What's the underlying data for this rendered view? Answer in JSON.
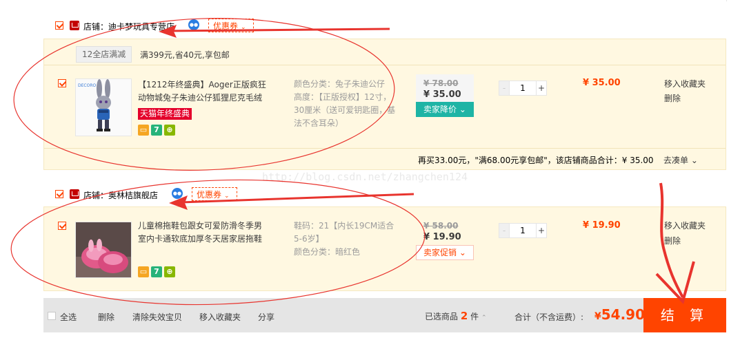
{
  "stores": [
    {
      "store_label": "店铺：",
      "store_name": "迪卡梦玩具专营店",
      "coupon_label": "优惠券",
      "promo_tag": "12全店满减",
      "promo_text": "满399元,省40元,享包邮",
      "item": {
        "title_line1": "【1212年终盛典】Aoger正版疯狂",
        "title_line2": "动物城兔子朱迪公仔狐狸尼克毛绒",
        "tmall_tag": "天猫年终盛典",
        "sku_line1": "颜色分类：兔子朱迪公仔",
        "sku_line2": "高度：【正版授权】12寸，",
        "sku_line3": "30厘米（送可爱钥匙圈，基",
        "sku_line4": "法不含耳朵）",
        "old_price": "¥ 78.00",
        "new_price": "¥ 35.00",
        "discount_label": "卖家降价",
        "quantity": "1",
        "subtotal": "¥ 35.00",
        "op_fav": "移入收藏夹",
        "op_del": "删除"
      },
      "footer_text": "再买33.00元，\"满68.00元享包邮\"，该店铺商品合计：¥ 35.00",
      "footer_link": "去凑单"
    },
    {
      "store_label": "店铺：",
      "store_name": "奥林桔旗舰店",
      "coupon_label": "优惠券",
      "item": {
        "title_line1": "儿童棉拖鞋包跟女可爱防滑冬季男",
        "title_line2": "室内卡通软底加厚冬天居家居拖鞋",
        "sku_line1": "鞋码：21【内长19CM适合",
        "sku_line2": "5-6岁】",
        "sku_line3": "颜色分类：暗红色",
        "old_price": "¥ 58.00",
        "new_price": "¥ 19.90",
        "discount_label": "卖家促销",
        "quantity": "1",
        "subtotal": "¥ 19.90",
        "op_fav": "移入收藏夹",
        "op_del": "删除"
      }
    }
  ],
  "bottom": {
    "select_all": "全选",
    "delete": "删除",
    "clear_invalid": "清除失效宝贝",
    "move_fav": "移入收藏夹",
    "share": "分享",
    "selected_label": "已选商品",
    "selected_count": "2",
    "selected_unit": "件",
    "total_label": "合计（不含运费）:",
    "total_currency": "¥",
    "total_value": "54.90",
    "checkout": "结 算"
  },
  "watermark": "http://blog.csdn.net/zhangchen124",
  "colors": {
    "accent": "#ff4400",
    "promo_green": "#1eb4a5",
    "annotation": "#e8342e"
  }
}
